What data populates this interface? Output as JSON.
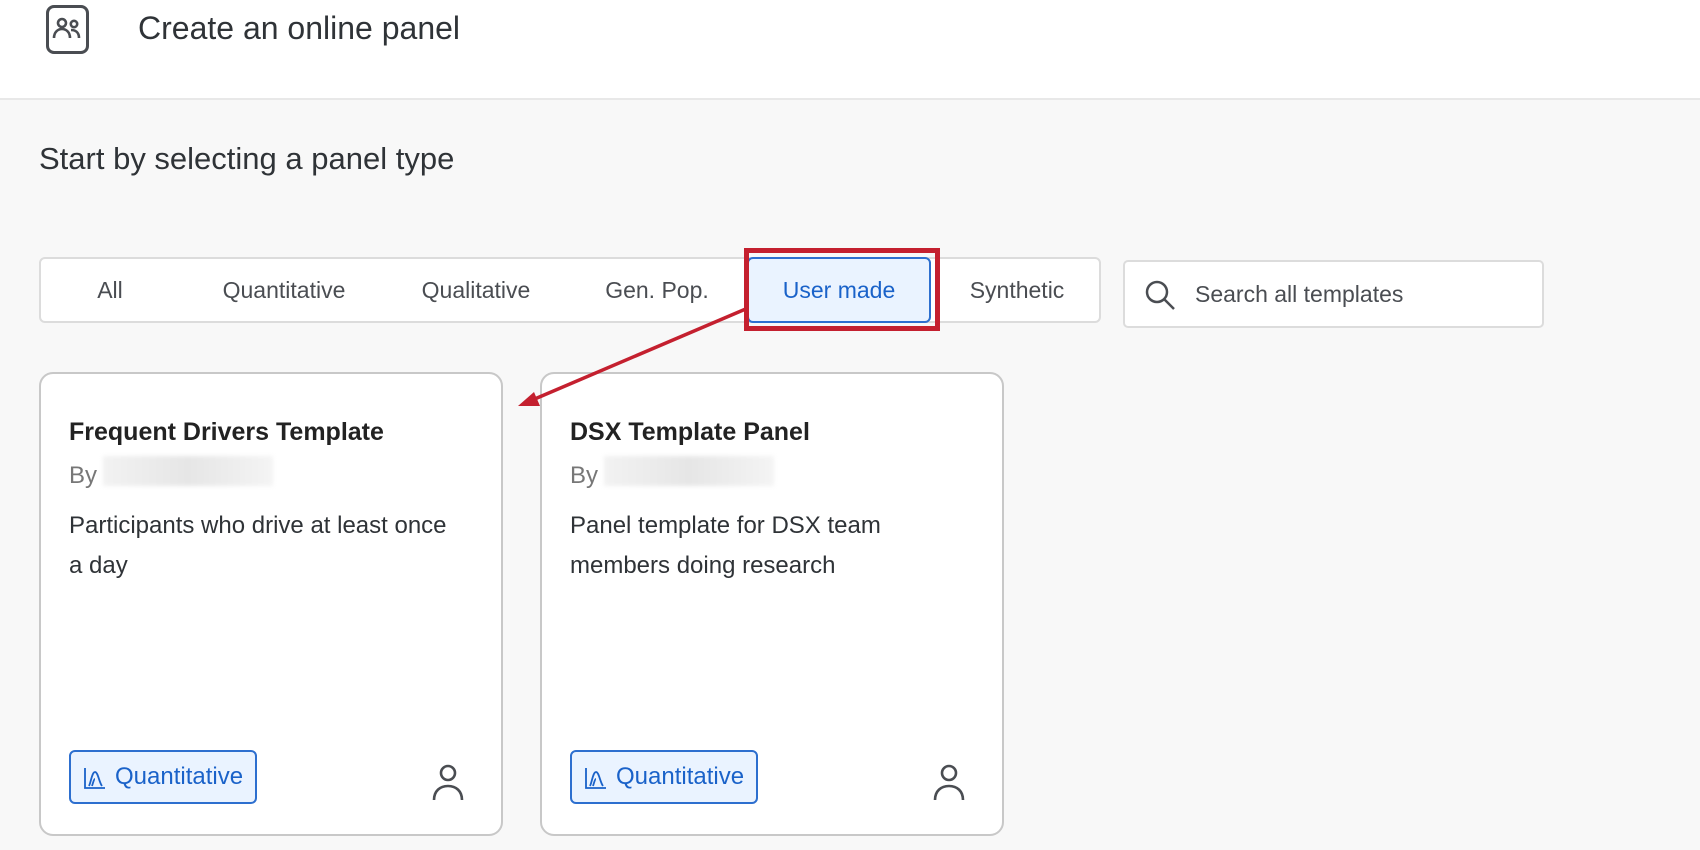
{
  "header": {
    "title": "Create an online panel",
    "icon": "people-icon"
  },
  "subtitle": "Start by selecting a panel type",
  "tabs": [
    {
      "label": "All"
    },
    {
      "label": "Quantitative"
    },
    {
      "label": "Qualitative"
    },
    {
      "label": "Gen. Pop."
    },
    {
      "label": "User made",
      "active": true
    },
    {
      "label": "Synthetic"
    }
  ],
  "search": {
    "placeholder": "Search all templates",
    "value": ""
  },
  "cards": [
    {
      "title": "Frequent Drivers Template",
      "by": "By",
      "description": "Participants who drive at least once a day",
      "badge": "Quantitative"
    },
    {
      "title": "DSX Template Panel",
      "by": "By",
      "description": "Panel template for DSX team members doing research",
      "badge": "Quantitative"
    }
  ],
  "colors": {
    "accent": "#1a62c9",
    "highlight": "#c4202f"
  }
}
